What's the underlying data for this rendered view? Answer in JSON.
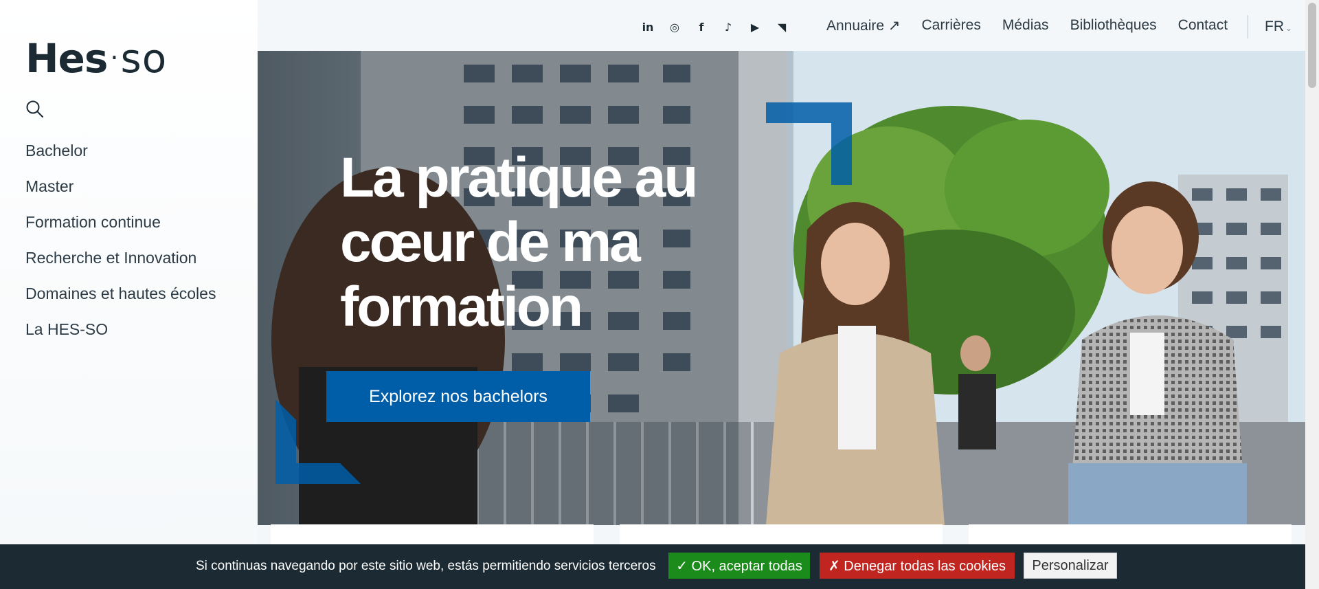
{
  "logo": {
    "main": "Hes",
    "dot": "·",
    "suffix": "so"
  },
  "sidebar": {
    "items": [
      {
        "label": "Bachelor"
      },
      {
        "label": "Master"
      },
      {
        "label": "Formation continue"
      },
      {
        "label": "Recherche et Innovation"
      },
      {
        "label": "Domaines et hautes écoles"
      },
      {
        "label": "La HES-SO"
      }
    ]
  },
  "header": {
    "social": [
      {
        "icon": "linkedin-icon",
        "glyph": "in"
      },
      {
        "icon": "instagram-icon",
        "glyph": "◎"
      },
      {
        "icon": "facebook-icon",
        "glyph": "f"
      },
      {
        "icon": "tiktok-icon",
        "glyph": "♪"
      },
      {
        "icon": "youtube-icon",
        "glyph": "▶"
      },
      {
        "icon": "rss-icon",
        "glyph": "◥"
      }
    ],
    "links": [
      {
        "label": "Annuaire ↗"
      },
      {
        "label": "Carrières"
      },
      {
        "label": "Médias"
      },
      {
        "label": "Bibliothèques"
      },
      {
        "label": "Contact"
      }
    ],
    "language": "FR",
    "language_chevron": "⌄"
  },
  "hero": {
    "headline": "La pratique au cœur de ma formation",
    "cta_label": "Explorez nos bachelors"
  },
  "cookie": {
    "message": "Si continuas navegando por este sitio web, estás permitiendo servicios terceros",
    "accept_label": "✓ OK, aceptar todas",
    "deny_label": "✗ Denegar todas las cookies",
    "personalize_label": "Personalizar"
  },
  "colors": {
    "brand_blue": "#005ea8",
    "dark": "#1c2b33",
    "accept": "#1b8c1b",
    "deny": "#c0261f"
  }
}
